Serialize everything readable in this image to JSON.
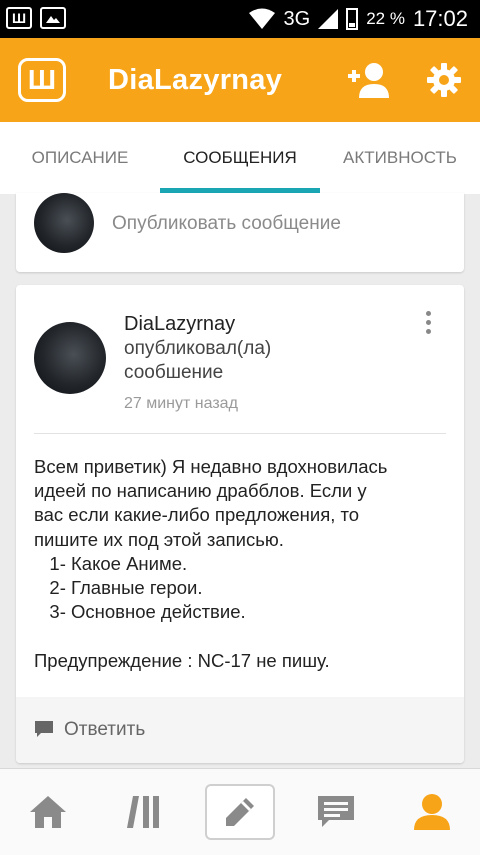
{
  "status_bar": {
    "network": "3G",
    "battery": "22 %",
    "time": "17:02",
    "icons": [
      "app-w-icon",
      "image-icon",
      "wifi-icon",
      "signal-icon",
      "battery-icon"
    ]
  },
  "app_bar": {
    "logo": "Ш",
    "title": "DiaLazyrnay",
    "accent": "#f7a418",
    "icons": [
      "add-user-icon",
      "gear-icon"
    ]
  },
  "tabs": [
    {
      "label": "ОПИСАНИЕ"
    },
    {
      "label": "СООБЩЕНИЯ",
      "active": true
    },
    {
      "label": "АКТИВНОСТЬ"
    }
  ],
  "tab_indicator_color": "#1ba6b4",
  "composer": {
    "placeholder": "Опубликовать сообщение"
  },
  "post": {
    "author": "DiaLazyrnay",
    "action_line1": "опубликовал(ла)",
    "action_line2": "сообшение",
    "time": "27 минут назад",
    "body_lines": [
      "Всем приветик) Я недавно вдохновилась",
      "идеей по написанию драбблов. Если у",
      "вас если какие-либо предложения, то",
      "пишите их под этой записью.",
      "   1- Какое Аниме.",
      "   2- Главные герои.",
      "   3- Основное действие.",
      "",
      "Предупреждение : NC-17 не пишу."
    ],
    "reply_label": "Ответить"
  },
  "bottom_nav": {
    "items": [
      "home-icon",
      "library-icon",
      "pencil-icon",
      "messages-icon",
      "profile-icon"
    ],
    "active": "profile-icon",
    "active_color": "#f7a418"
  }
}
